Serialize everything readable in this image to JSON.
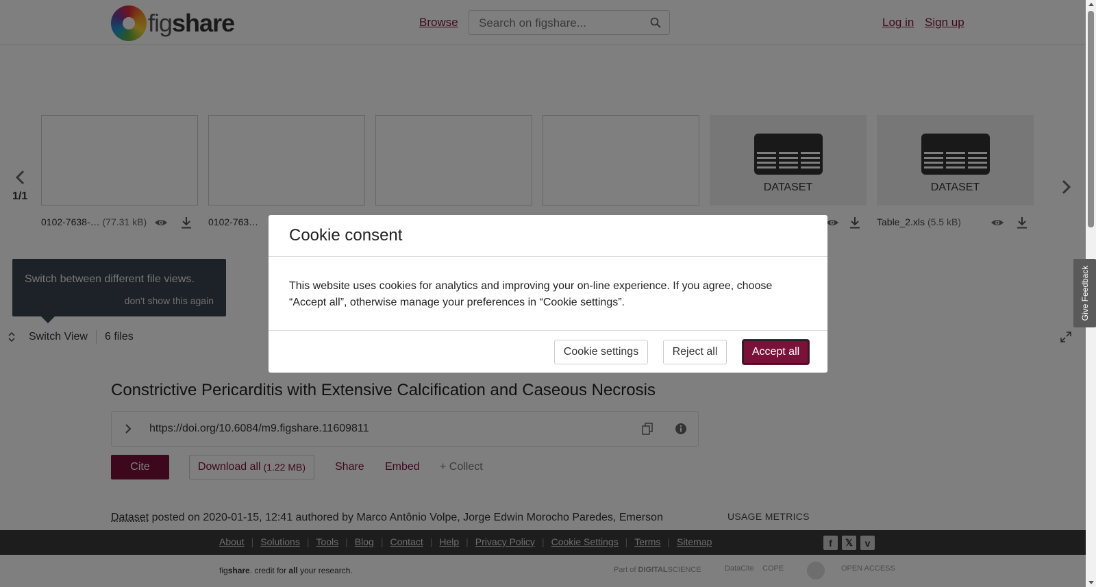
{
  "header": {
    "logo_prefix": "fig",
    "logo_suffix": "share",
    "browse_label": "Browse",
    "search_placeholder": "Search on figshare...",
    "login_label": "Log in",
    "signup_label": "Sign up"
  },
  "file_strip": {
    "page_indicator": "1/1",
    "dataset_label": "DATASET",
    "files": [
      {
        "name": "0102-7638-…",
        "size": "(77.31 kB)"
      },
      {
        "name": "0102-763…",
        "size": ""
      },
      {
        "name": "",
        "size": ""
      },
      {
        "name": "",
        "size": ""
      },
      {
        "name": "",
        "size": ""
      },
      {
        "name": "Table_2.xls",
        "size": "(5.5 kB)"
      }
    ]
  },
  "tooltip": {
    "text": "Switch between different file views.",
    "dismiss_label": "don't show this again"
  },
  "switch_bar": {
    "label": "Switch View",
    "file_count": "6 files"
  },
  "article": {
    "title": "Constrictive Pericarditis with Extensive Calcification and Caseous Necrosis",
    "doi": "https://doi.org/10.6084/m9.figshare.11609811",
    "cite_label": "Cite",
    "download_label": "Download all",
    "download_size": "(1.22 MB)",
    "share_label": "Share",
    "embed_label": "Embed",
    "collect_label": "+ Collect",
    "item_type": "Dataset",
    "posted_text": " posted on 2020-01-15, 12:41 authored by Marco Antônio Volpe, Jorge Edwin Morocho Paredes, Emerson",
    "usage_heading": "USAGE METRICS"
  },
  "cookie_modal": {
    "title": "Cookie consent",
    "body": "This website uses cookies for analytics and improving your on-line experience. If you agree, choose “Accept all”, otherwise manage your preferences in “Cookie settings”.",
    "settings_label": "Cookie settings",
    "reject_label": "Reject all",
    "accept_label": "Accept all"
  },
  "footer": {
    "links": [
      "About",
      "Solutions",
      "Tools",
      "Blog",
      "Contact",
      "Help",
      "Privacy Policy",
      "Cookie Settings",
      "Terms",
      "Sitemap"
    ],
    "social": [
      "facebook-icon",
      "x-icon",
      "vimeo-icon"
    ],
    "tagline_prefix": "fig",
    "tagline_brand": "share",
    "tagline_mid": ". credit for ",
    "tagline_all": "all",
    "tagline_end": " your research."
  },
  "feedback_label": "Give Feedback",
  "colors": {
    "brand": "#7a1138",
    "footer_bg": "#3a3a3a",
    "tooltip_bg": "#3a4450"
  }
}
